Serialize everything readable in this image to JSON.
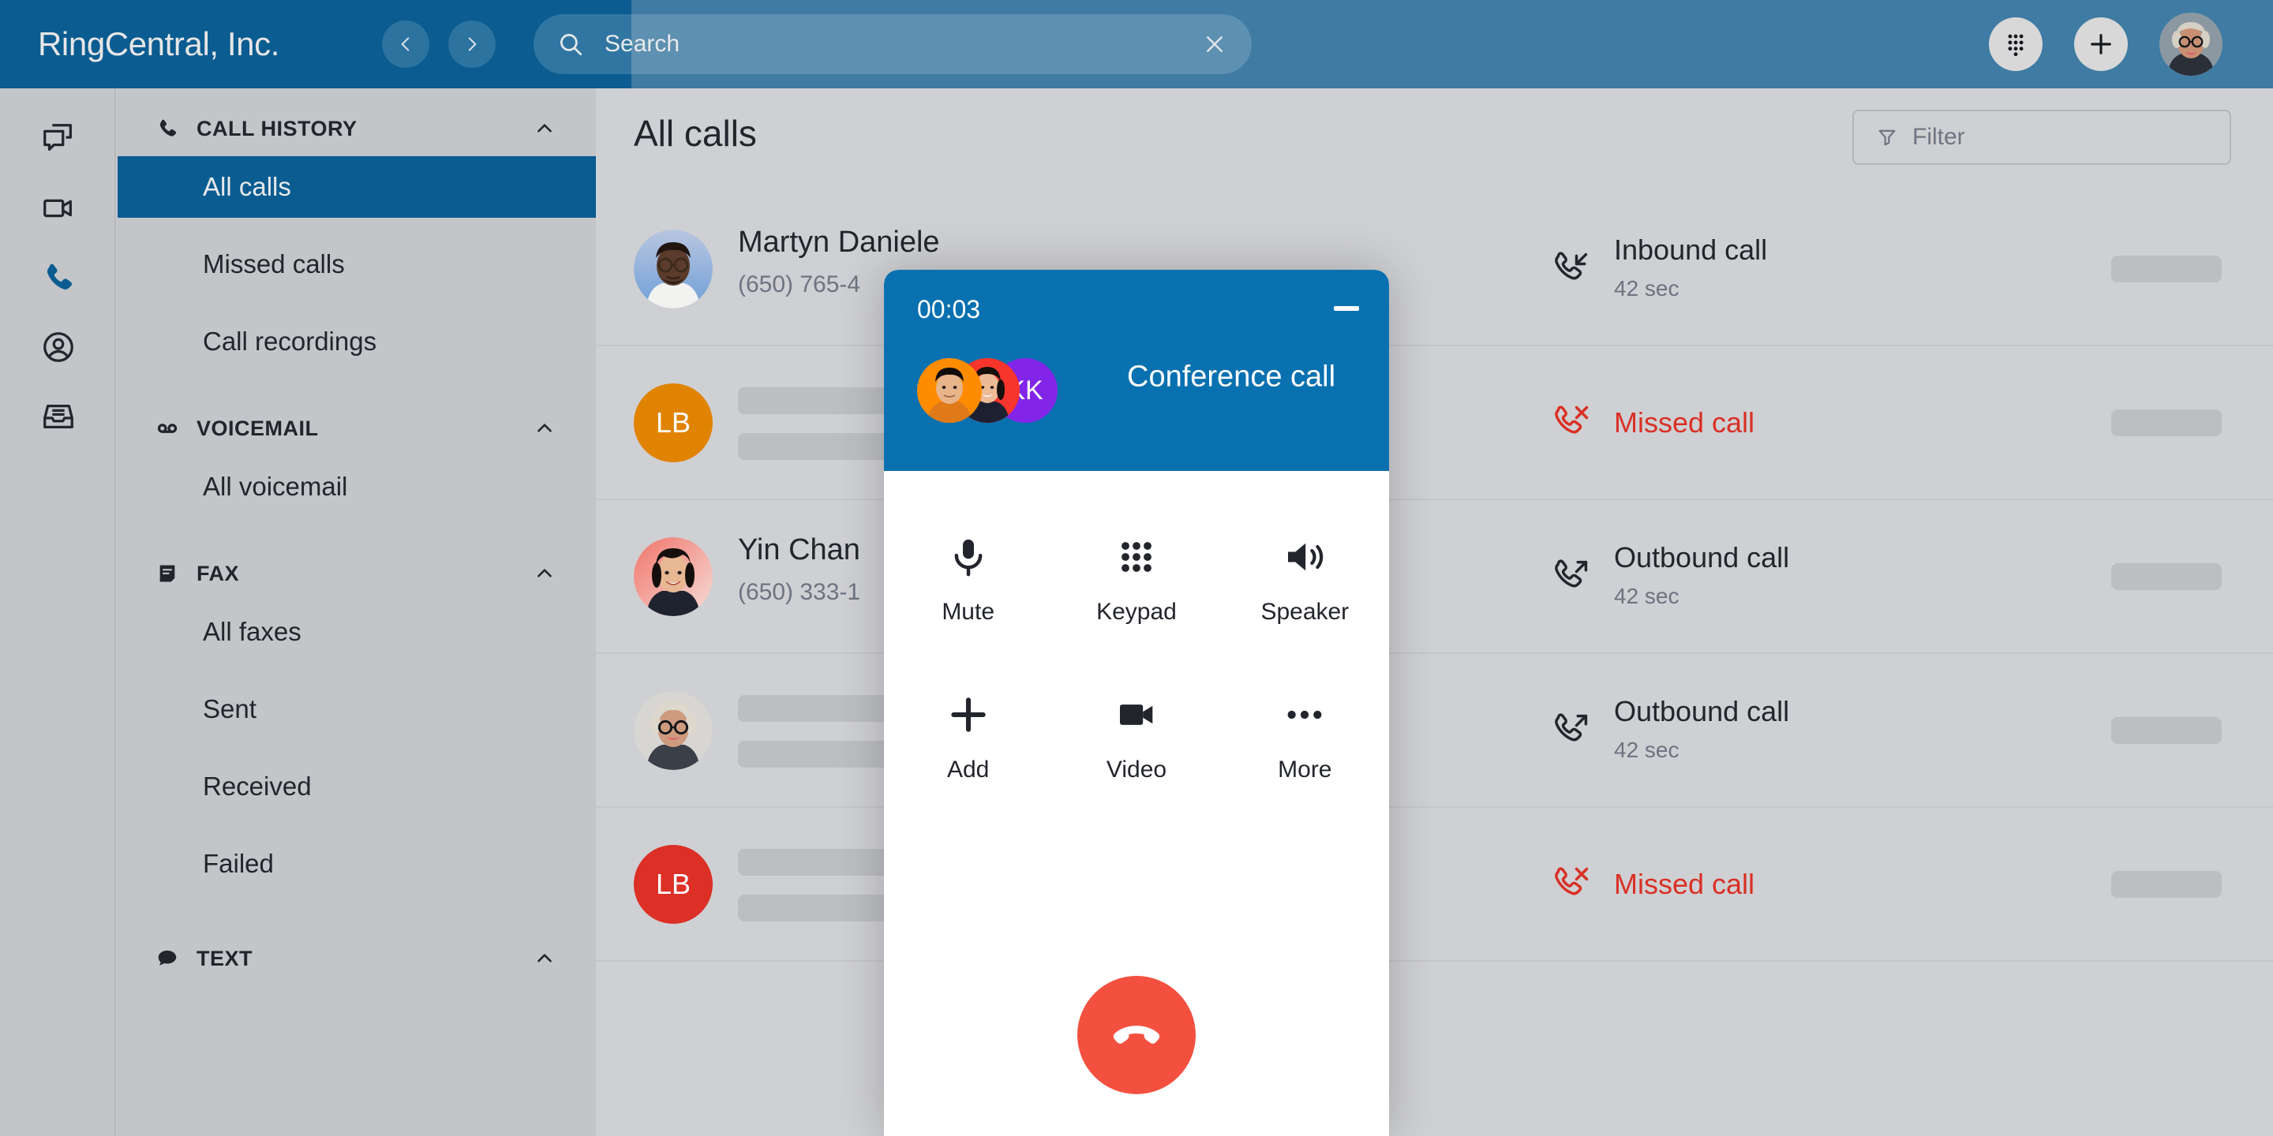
{
  "header": {
    "brand": "RingCentral, Inc.",
    "back_icon": "chevron-left-icon",
    "forward_icon": "chevron-right-icon",
    "search": {
      "icon": "search-icon",
      "placeholder": "Search",
      "value": "Search",
      "clear_icon": "close-icon"
    },
    "dialpad_icon": "dialpad-icon",
    "add_icon": "plus-icon",
    "avatar": "user-avatar"
  },
  "rail": [
    {
      "name": "message",
      "icon": "message-bubbles-icon",
      "active": false
    },
    {
      "name": "video",
      "icon": "video-camera-icon",
      "active": false
    },
    {
      "name": "phone",
      "icon": "phone-icon",
      "active": true
    },
    {
      "name": "contacts",
      "icon": "person-circle-icon",
      "active": false
    },
    {
      "name": "inbox",
      "icon": "inbox-tray-icon",
      "active": false
    }
  ],
  "sidebar": {
    "sections": [
      {
        "label": "CALL HISTORY",
        "icon": "phone-icon",
        "chevron": "chevron-up-icon",
        "items": [
          {
            "label": "All calls",
            "active": true
          },
          {
            "label": "Missed calls",
            "active": false
          },
          {
            "label": "Call recordings",
            "active": false
          }
        ]
      },
      {
        "label": "VOICEMAIL",
        "icon": "voicemail-icon",
        "chevron": "chevron-up-icon",
        "items": [
          {
            "label": "All voicemail",
            "active": false
          }
        ]
      },
      {
        "label": "FAX",
        "icon": "fax-document-icon",
        "chevron": "chevron-up-icon",
        "items": [
          {
            "label": "All faxes",
            "active": false
          },
          {
            "label": "Sent",
            "active": false
          },
          {
            "label": "Received",
            "active": false
          },
          {
            "label": "Failed",
            "active": false
          }
        ]
      },
      {
        "label": "TEXT",
        "icon": "chat-bubble-icon",
        "chevron": "chevron-up-icon",
        "items": []
      }
    ]
  },
  "main": {
    "title": "All calls",
    "filter": {
      "label": "Filter",
      "icon": "funnel-icon"
    },
    "rows": [
      {
        "name": "Martyn Daniele",
        "number": "(650) 765-4",
        "avatar_type": "photo",
        "avatar_variant": "man-glasses",
        "direction": "Inbound call",
        "direction_icon": "call-inbound-icon",
        "duration": "42 sec",
        "missed": false,
        "placeholder": false
      },
      {
        "name": "",
        "number": "",
        "avatar_type": "initials",
        "avatar_initials": "LB",
        "avatar_color": "#e08300",
        "direction": "Missed call",
        "direction_icon": "call-missed-icon",
        "duration": "",
        "missed": true,
        "placeholder": true
      },
      {
        "name": "Yin Chan",
        "number": "(650) 333-1",
        "avatar_type": "photo",
        "avatar_variant": "woman-dark-hair",
        "direction": "Outbound call",
        "direction_icon": "call-outbound-icon",
        "duration": "42 sec",
        "missed": false,
        "placeholder": false
      },
      {
        "name": "",
        "number": "",
        "avatar_type": "photo",
        "avatar_variant": "woman-glasses-grey",
        "direction": "Outbound call",
        "direction_icon": "call-outbound-icon",
        "duration": "42 sec",
        "missed": false,
        "placeholder": true
      },
      {
        "name": "",
        "number": "",
        "avatar_type": "initials",
        "avatar_initials": "LB",
        "avatar_color": "#dc2f26",
        "direction": "Missed call",
        "direction_icon": "call-missed-icon",
        "duration": "",
        "missed": true,
        "placeholder": true
      }
    ]
  },
  "call_widget": {
    "timer": "00:03",
    "minimize_icon": "minimize-icon",
    "title": "Conference call",
    "participants": [
      {
        "type": "photo",
        "variant": "man-orange",
        "color": "#ff8c00"
      },
      {
        "type": "photo",
        "variant": "woman-red",
        "color": "#f7352c"
      },
      {
        "type": "initials",
        "initials": "KK",
        "color": "#8225e8"
      }
    ],
    "controls": [
      {
        "label": "Mute",
        "icon": "microphone-icon"
      },
      {
        "label": "Keypad",
        "icon": "dialpad-icon"
      },
      {
        "label": "Speaker",
        "icon": "speaker-icon"
      },
      {
        "label": "Add",
        "icon": "plus-icon"
      },
      {
        "label": "Video",
        "icon": "video-camera-icon"
      },
      {
        "label": "More",
        "icon": "ellipsis-icon"
      }
    ],
    "hangup": {
      "icon": "hangup-phone-icon",
      "color": "#f4503f"
    }
  },
  "colors": {
    "brand_dark": "#0a5c91",
    "brand_header": "#3f7ba3",
    "widget_header": "#0a71b0",
    "missed_red": "#d93025",
    "hangup_red": "#f4503f",
    "panel_grey": "#c3c5c9",
    "main_grey": "#cfd0d3"
  }
}
